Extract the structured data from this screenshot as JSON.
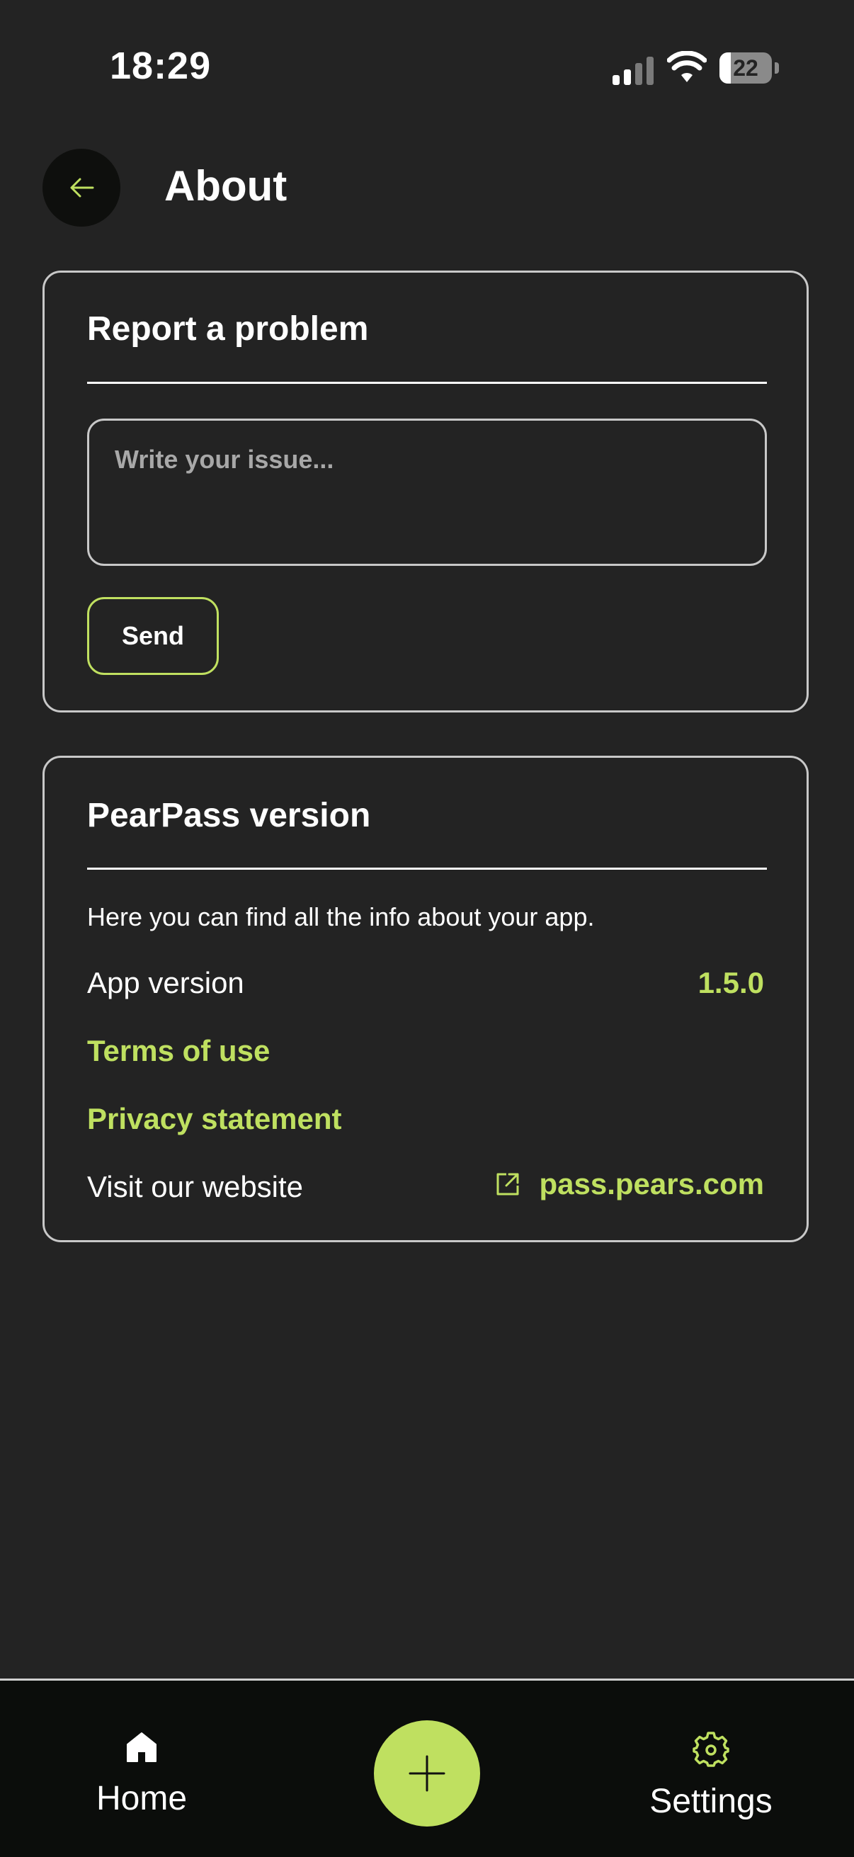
{
  "status_bar": {
    "time": "18:29",
    "battery": "22",
    "battery_level": 0.22
  },
  "header": {
    "title": "About",
    "back_icon": "arrow-left-icon"
  },
  "report": {
    "title": "Report a problem",
    "placeholder": "Write your issue...",
    "send_label": "Send"
  },
  "version_card": {
    "title": "PearPass version",
    "description": "Here you can find all the info about your app.",
    "app_version_label": "App version",
    "app_version_value": "1.5.0",
    "terms_label": "Terms of use",
    "privacy_label": "Privacy statement",
    "website_label": "Visit our website",
    "website_link": "pass.pears.com",
    "website_icon": "external-link-icon"
  },
  "nav": {
    "home_label": "Home",
    "settings_label": "Settings",
    "home_icon": "home-icon",
    "add_icon": "plus-icon",
    "settings_icon": "gear-icon"
  },
  "colors": {
    "accent": "#bfe060",
    "background": "#232323",
    "nav_background": "#0b0d0b"
  }
}
